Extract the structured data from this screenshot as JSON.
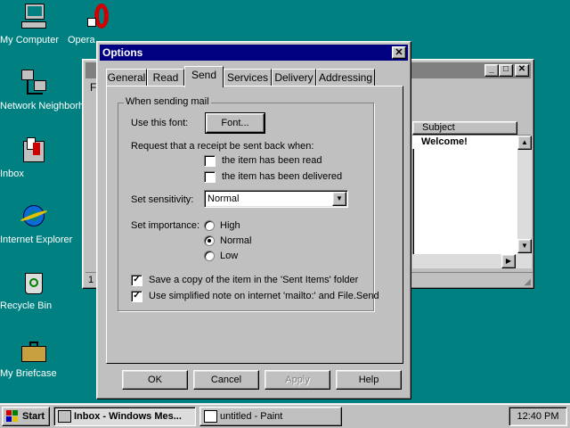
{
  "desktop": {
    "icons": [
      {
        "label": "My Computer",
        "icon": "my-computer-icon"
      },
      {
        "label": "Opera",
        "icon": "opera-icon"
      },
      {
        "label": "Network Neighborhood",
        "icon": "network-neighborhood-icon"
      },
      {
        "label": "Inbox",
        "icon": "inbox-icon"
      },
      {
        "label": "Internet Explorer",
        "icon": "internet-explorer-icon"
      },
      {
        "label": "Recycle Bin",
        "icon": "recycle-bin-icon"
      },
      {
        "label": "My Briefcase",
        "icon": "briefcase-icon"
      }
    ]
  },
  "background_window": {
    "menu_letter": "F",
    "column_header": "Subject",
    "row_subject": "Welcome!",
    "status_number": "1"
  },
  "dialog": {
    "title": "Options",
    "tabs": [
      "General",
      "Read",
      "Send",
      "Services",
      "Delivery",
      "Addressing"
    ],
    "active_tab": "Send",
    "group_title": "When sending mail",
    "font_label": "Use this font:",
    "font_button": "Font...",
    "receipt_label": "Request that a receipt be sent back when:",
    "receipt_read": "the item has been read",
    "receipt_delivered": "the item has been delivered",
    "sensitivity_label": "Set sensitivity:",
    "sensitivity_value": "Normal",
    "importance_label": "Set importance:",
    "importance_high": "High",
    "importance_normal": "Normal",
    "importance_low": "Low",
    "save_copy": "Save a copy of the item in the 'Sent Items' folder",
    "simplified_note": "Use simplified note on internet 'mailto:' and File.Send",
    "buttons": {
      "ok": "OK",
      "cancel": "Cancel",
      "apply": "Apply",
      "help": "Help"
    }
  },
  "taskbar": {
    "start": "Start",
    "tasks": [
      "Inbox - Windows Mes...",
      "untitled - Paint"
    ],
    "clock": "12:40 PM"
  },
  "colors": {
    "desktop": "#008080",
    "titlebar_active": "#000080",
    "titlebar_inactive": "#808080",
    "face": "#c0c0c0"
  }
}
